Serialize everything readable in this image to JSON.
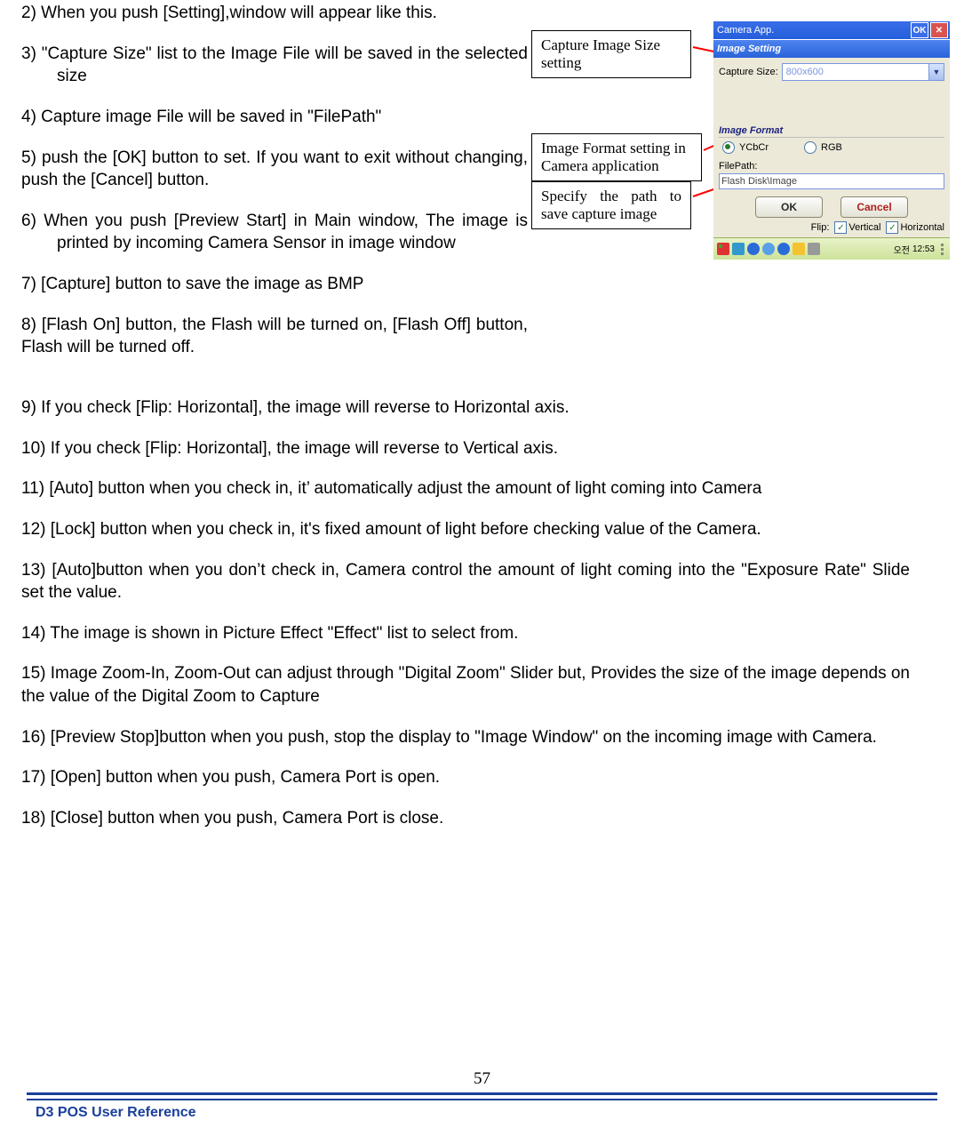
{
  "steps_narrow": [
    "2) When you push [Setting],window will appear like this.",
    "3) \"Capture Size\" list to the Image File will be saved in the selected size",
    "4) Capture image File will be saved in \"FilePath\"",
    "5) push the [OK] button to set. If you want to exit without changing, push the [Cancel] button.",
    "6) When you push [Preview Start] in Main window, The image is printed by incoming Camera Sensor in image window",
    "7) [Capture] button to save the image as BMP",
    "8) [Flash On] button, the Flash will be turned on, [Flash Off] button, Flash will be turned off."
  ],
  "steps_wide": [
    "9) If you check [Flip: Horizontal], the image will reverse to Horizontal axis.",
    "10) If you check [Flip: Horizontal], the image will reverse to Vertical axis.",
    "11) [Auto] button when you check in, it’  automatically adjust the amount of light coming into Camera",
    "12) [Lock] button when you check in, it's fixed amount of light before checking value of the Camera.",
    "13) [Auto]button when you don’t check in, Camera control the amount of light coming into the \"Exposure Rate\" Slide set the value.",
    "14) The image is shown in Picture Effect \"Effect\" list to select from.",
    "15) Image Zoom-In, Zoom-Out can adjust through \"Digital Zoom\" Slider but, Provides the size of the image depends on the value of the Digital Zoom to Capture",
    "16) [Preview Stop]button when you push, stop the display to \"Image Window\" on the incoming image with Camera.",
    "17) [Open] button when you push, Camera Port is open.",
    "18) [Close] button when you push, Camera Port is close."
  ],
  "callouts": {
    "c1": "Capture Image Size setting",
    "c2": "Image Format setting in Camera application",
    "c3": "Specify the path to save capture image"
  },
  "app": {
    "title": "Camera App.",
    "ok_label": "OK",
    "section": "Image Setting",
    "capture_size_label": "Capture Size:",
    "capture_size_value": "800x600",
    "image_format_label": "Image Format",
    "ycbcr": "YCbCr",
    "rgb": "RGB",
    "filepath_label": "FilePath:",
    "filepath_value": "Flash Disk\\Image",
    "btn_ok": "OK",
    "btn_cancel": "Cancel",
    "flip_label": "Flip:",
    "flip_v": "Vertical",
    "flip_h": "Horizontal",
    "clock_prefix": "오전",
    "clock_time": "12:53"
  },
  "footer": {
    "page_number": "57",
    "ref": "D3 POS User Reference"
  }
}
